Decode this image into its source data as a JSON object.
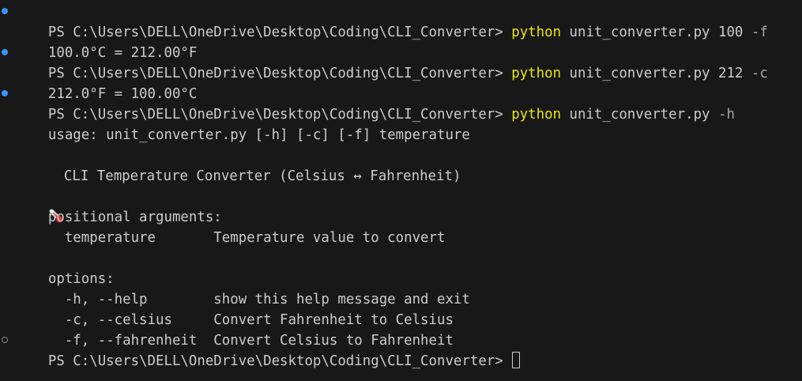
{
  "colors": {
    "background": "#181818",
    "text": "#cccccc",
    "command": "#e5e510",
    "flag": "#a8a8a8",
    "success_dot": "#3794ff",
    "idle_dot": "#8a8a8a"
  },
  "prompt": "PS C:\\Users\\DELL\\OneDrive\\Desktop\\Coding\\CLI_Converter> ",
  "commands": [
    {
      "cmd": "python",
      "args": " unit_converter.py 100 ",
      "flag": "-f",
      "output": "100.0°C = 212.00°F"
    },
    {
      "cmd": "python",
      "args": " unit_converter.py 212 ",
      "flag": "-c",
      "output": "212.0°F = 100.00°C"
    },
    {
      "cmd": "python",
      "args": " unit_converter.py ",
      "flag": "-h"
    }
  ],
  "help": {
    "usage": "usage: unit_converter.py [-h] [-c] [-f] temperature",
    "description_icon": "thermometer-icon",
    "description": "CLI Temperature Converter (Celsius ↔ Fahrenheit)",
    "positional_header": "positional arguments:",
    "positional": [
      {
        "name": "  temperature       ",
        "desc": "Temperature value to convert"
      }
    ],
    "options_header": "options:",
    "options": [
      {
        "name": "  -h, --help        ",
        "desc": "show this help message and exit"
      },
      {
        "name": "  -c, --celsius     ",
        "desc": "Convert Fahrenheit to Celsius"
      },
      {
        "name": "  -f, --fahrenheit  ",
        "desc": "Convert Celsius to Fahrenheit"
      }
    ]
  }
}
